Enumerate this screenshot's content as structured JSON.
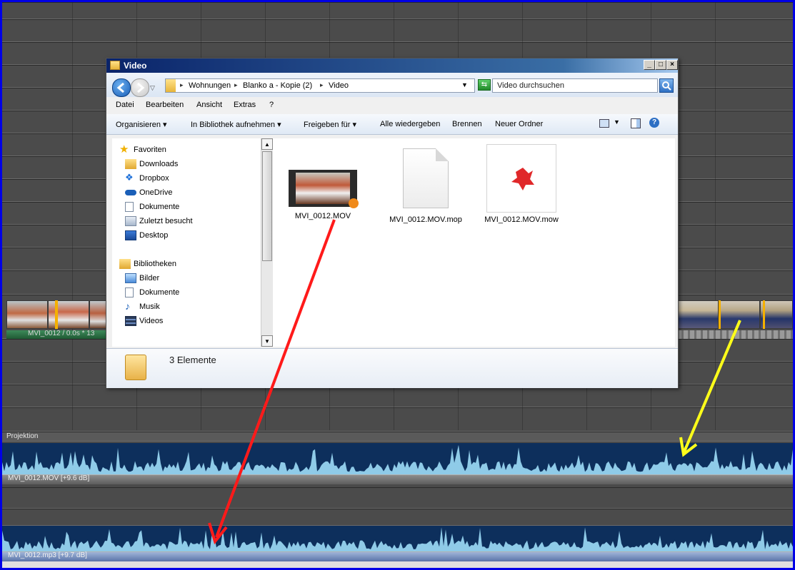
{
  "timeline": {
    "video_clip_label": "MVI_0012 / 0.0s * 13",
    "projection_label": "Projektion",
    "audio1_label": "MVI_0012.MOV [+9.6 dB]",
    "audio2_label": "MVI_0012.mp3 [+9.7 dB]",
    "colors": {
      "waveform_bg": "#0d2f5c",
      "waveform": "#8fcbe8",
      "track_bg": "#4b4b4b"
    }
  },
  "explorer": {
    "title": "Video",
    "title_buttons": [
      "_",
      "□",
      "×"
    ],
    "breadcrumb": [
      "Wohnungen",
      "Blanko a - Kopie (2)",
      "Video"
    ],
    "search_placeholder": "Video durchsuchen",
    "menu": [
      "Datei",
      "Bearbeiten",
      "Ansicht",
      "Extras",
      "?"
    ],
    "commands": {
      "organize": "Organisieren",
      "library": "In Bibliothek aufnehmen",
      "share": "Freigeben für",
      "play_all": "Alle wiedergeben",
      "burn": "Brennen",
      "new_folder": "Neuer Ordner"
    },
    "nav": {
      "favorites_header": "Favoriten",
      "favorites": [
        "Downloads",
        "Dropbox",
        "OneDrive",
        "Dokumente",
        "Zuletzt besucht",
        "Desktop"
      ],
      "libraries_header": "Bibliotheken",
      "libraries": [
        "Bilder",
        "Dokumente",
        "Musik",
        "Videos"
      ]
    },
    "files": [
      {
        "name": "MVI_0012.MOV",
        "type": "video",
        "icon": "video-thumbnail-icon"
      },
      {
        "name": "MVI_0012.MOV.mop",
        "type": "blank",
        "icon": "blank-file-icon"
      },
      {
        "name": "MVI_0012.MOV.mow",
        "type": "app",
        "icon": "app-file-icon"
      }
    ],
    "status_count": "3 Elemente"
  },
  "annotations": {
    "arrow1_color": "#ff1a1a",
    "arrow2_color": "#ffff1a"
  }
}
